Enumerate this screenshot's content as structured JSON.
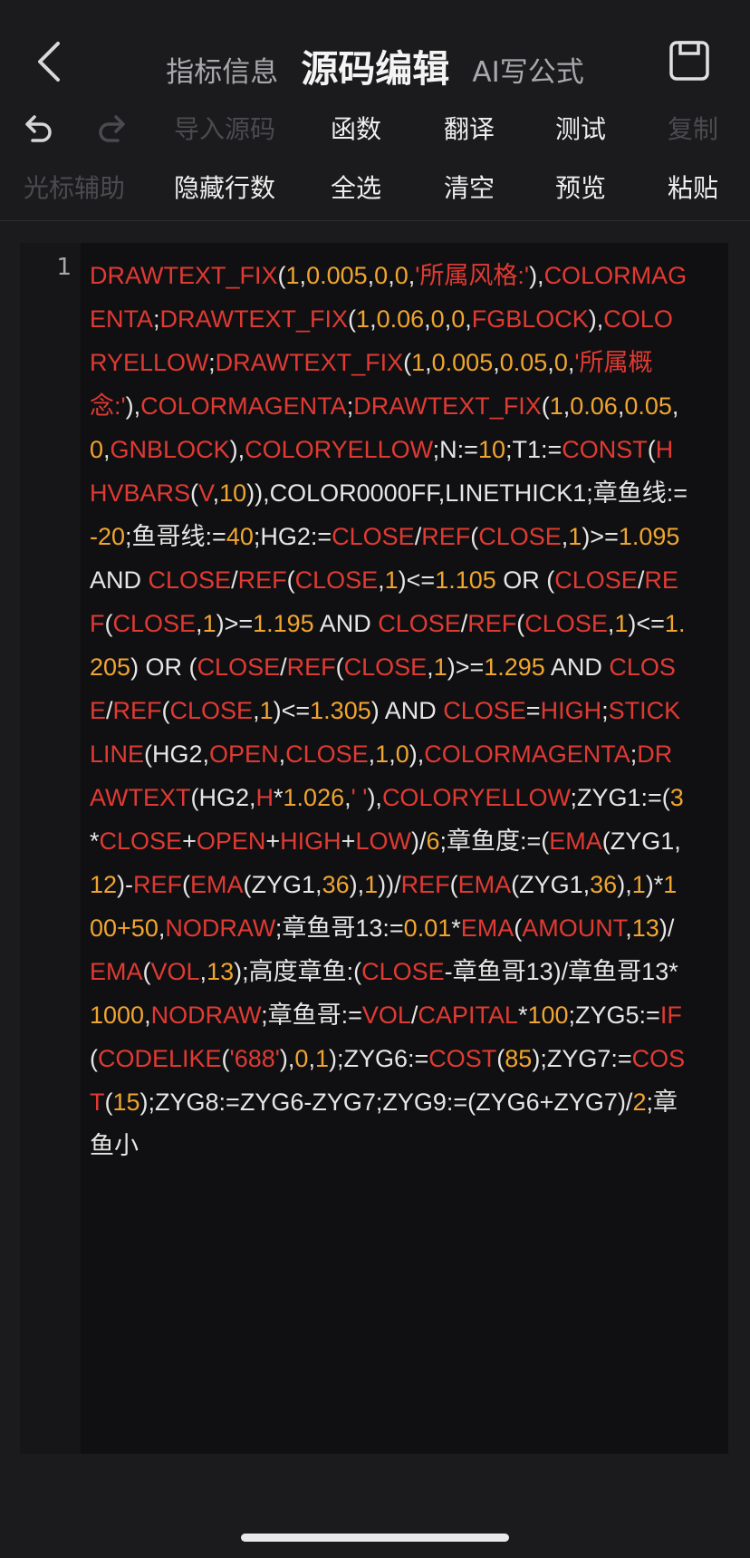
{
  "nav": {
    "tabs": [
      {
        "label": "指标信息"
      },
      {
        "label": "源码编辑"
      },
      {
        "label": "AI写公式"
      }
    ]
  },
  "toolbar": {
    "row1": {
      "undo": "undo-icon",
      "redo": "redo-icon",
      "import_source": "导入源码",
      "functions": "函数",
      "translate": "翻译",
      "test": "测试",
      "copy": "复制"
    },
    "row2": {
      "cursor_assist": "光标辅助",
      "hide_line_numbers": "隐藏行数",
      "select_all": "全选",
      "clear": "清空",
      "preview": "预览",
      "paste": "粘贴"
    }
  },
  "editor": {
    "line_number": "1",
    "tokens": [
      [
        "f",
        "DRAWTEXT_FIX"
      ],
      [
        "p",
        "("
      ],
      [
        "n",
        "1"
      ],
      [
        "p",
        ","
      ],
      [
        "n",
        "0.005"
      ],
      [
        "p",
        ","
      ],
      [
        "n",
        "0"
      ],
      [
        "p",
        ","
      ],
      [
        "n",
        "0"
      ],
      [
        "p",
        ","
      ],
      [
        "s",
        "'所属风格:'"
      ],
      [
        "p",
        "),"
      ],
      [
        "f",
        "COLORMAGENTA"
      ],
      [
        "p",
        ";"
      ],
      [
        "f",
        "DRAWTEXT_FIX"
      ],
      [
        "p",
        "("
      ],
      [
        "n",
        "1"
      ],
      [
        "p",
        ","
      ],
      [
        "n",
        "0.06"
      ],
      [
        "p",
        ","
      ],
      [
        "n",
        "0"
      ],
      [
        "p",
        ","
      ],
      [
        "n",
        "0"
      ],
      [
        "p",
        ","
      ],
      [
        "f",
        "FGBLOCK"
      ],
      [
        "p",
        "),"
      ],
      [
        "f",
        "COLORYELLOW"
      ],
      [
        "p",
        ";"
      ],
      [
        "f",
        "DRAWTEXT_FIX"
      ],
      [
        "p",
        "("
      ],
      [
        "n",
        "1"
      ],
      [
        "p",
        ","
      ],
      [
        "n",
        "0.005"
      ],
      [
        "p",
        ","
      ],
      [
        "n",
        "0.05"
      ],
      [
        "p",
        ","
      ],
      [
        "n",
        "0"
      ],
      [
        "p",
        ","
      ],
      [
        "s",
        "'所属概念:'"
      ],
      [
        "p",
        "),"
      ],
      [
        "f",
        "COLORMAGENTA"
      ],
      [
        "p",
        ";"
      ],
      [
        "f",
        "DRAWTEXT_FIX"
      ],
      [
        "p",
        "("
      ],
      [
        "n",
        "1"
      ],
      [
        "p",
        ","
      ],
      [
        "n",
        "0.06"
      ],
      [
        "p",
        ","
      ],
      [
        "n",
        "0.05"
      ],
      [
        "p",
        ","
      ],
      [
        "n",
        "0"
      ],
      [
        "p",
        ","
      ],
      [
        "f",
        "GNBLOCK"
      ],
      [
        "p",
        "),"
      ],
      [
        "f",
        "COLORYELLOW"
      ],
      [
        "p",
        ";N:="
      ],
      [
        "n",
        "10"
      ],
      [
        "p",
        ";T1:="
      ],
      [
        "f",
        "CONST"
      ],
      [
        "p",
        "("
      ],
      [
        "f",
        "HHVBARS"
      ],
      [
        "p",
        "("
      ],
      [
        "f",
        "V"
      ],
      [
        "p",
        ","
      ],
      [
        "n",
        "10"
      ],
      [
        "p",
        "))"
      ],
      [
        "p",
        ",COLOR0000FF,LINETHICK1;章鱼线:="
      ],
      [
        "n",
        "-20"
      ],
      [
        "p",
        ";鱼哥线:="
      ],
      [
        "n",
        "40"
      ],
      [
        "p",
        ";HG2:="
      ],
      [
        "f",
        "CLOSE"
      ],
      [
        "p",
        "/"
      ],
      [
        "f",
        "REF"
      ],
      [
        "p",
        "("
      ],
      [
        "f",
        "CLOSE"
      ],
      [
        "p",
        ","
      ],
      [
        "n",
        "1"
      ],
      [
        "p",
        ")>="
      ],
      [
        "n",
        "1.095"
      ],
      [
        "p",
        " AND "
      ],
      [
        "f",
        "CLOSE"
      ],
      [
        "p",
        "/"
      ],
      [
        "f",
        "REF"
      ],
      [
        "p",
        "("
      ],
      [
        "f",
        "CLOSE"
      ],
      [
        "p",
        ","
      ],
      [
        "n",
        "1"
      ],
      [
        "p",
        ")<="
      ],
      [
        "n",
        "1.105"
      ],
      [
        "p",
        " OR ("
      ],
      [
        "f",
        "CLOSE"
      ],
      [
        "p",
        "/"
      ],
      [
        "f",
        "REF"
      ],
      [
        "p",
        "("
      ],
      [
        "f",
        "CLOSE"
      ],
      [
        "p",
        ","
      ],
      [
        "n",
        "1"
      ],
      [
        "p",
        ")>="
      ],
      [
        "n",
        "1.195"
      ],
      [
        "p",
        " AND "
      ],
      [
        "f",
        "CLOSE"
      ],
      [
        "p",
        "/"
      ],
      [
        "f",
        "REF"
      ],
      [
        "p",
        "("
      ],
      [
        "f",
        "CLOSE"
      ],
      [
        "p",
        ","
      ],
      [
        "n",
        "1"
      ],
      [
        "p",
        ")<="
      ],
      [
        "n",
        "1.205"
      ],
      [
        "p",
        ") OR ("
      ],
      [
        "f",
        "CLOSE"
      ],
      [
        "p",
        "/"
      ],
      [
        "f",
        "REF"
      ],
      [
        "p",
        "("
      ],
      [
        "f",
        "CLOSE"
      ],
      [
        "p",
        ","
      ],
      [
        "n",
        "1"
      ],
      [
        "p",
        ")>="
      ],
      [
        "n",
        "1.295"
      ],
      [
        "p",
        " AND "
      ],
      [
        "f",
        "CLOSE"
      ],
      [
        "p",
        "/"
      ],
      [
        "f",
        "REF"
      ],
      [
        "p",
        "("
      ],
      [
        "f",
        "CLOSE"
      ],
      [
        "p",
        ","
      ],
      [
        "n",
        "1"
      ],
      [
        "p",
        ")<="
      ],
      [
        "n",
        "1.305"
      ],
      [
        "p",
        ") AND "
      ],
      [
        "f",
        "CLOSE"
      ],
      [
        "p",
        "="
      ],
      [
        "f",
        "HIGH"
      ],
      [
        "p",
        ";"
      ],
      [
        "f",
        "STICKLINE"
      ],
      [
        "p",
        "(HG2,"
      ],
      [
        "f",
        "OPEN"
      ],
      [
        "p",
        ","
      ],
      [
        "f",
        "CLOSE"
      ],
      [
        "p",
        ","
      ],
      [
        "n",
        "1"
      ],
      [
        "p",
        ","
      ],
      [
        "n",
        "0"
      ],
      [
        "p",
        "),"
      ],
      [
        "f",
        "COLORMAGENTA"
      ],
      [
        "p",
        ";"
      ],
      [
        "f",
        "DRAWTEXT"
      ],
      [
        "p",
        "(HG2,"
      ],
      [
        "f",
        "H"
      ],
      [
        "p",
        "*"
      ],
      [
        "n",
        "1.026"
      ],
      [
        "p",
        ","
      ],
      [
        "s",
        "' '"
      ],
      [
        "p",
        "),"
      ],
      [
        "f",
        "COLORYELLOW"
      ],
      [
        "p",
        ";ZYG1:=("
      ],
      [
        "n",
        "3"
      ],
      [
        "p",
        "*"
      ],
      [
        "f",
        "CLOSE"
      ],
      [
        "p",
        "+"
      ],
      [
        "f",
        "OPEN"
      ],
      [
        "p",
        "+"
      ],
      [
        "f",
        "HIGH"
      ],
      [
        "p",
        "+"
      ],
      [
        "f",
        "LOW"
      ],
      [
        "p",
        ")/"
      ],
      [
        "n",
        "6"
      ],
      [
        "p",
        ";章鱼度:=("
      ],
      [
        "f",
        "EMA"
      ],
      [
        "p",
        "(ZYG1,"
      ],
      [
        "n",
        "12"
      ],
      [
        "p",
        ")-"
      ],
      [
        "f",
        "REF"
      ],
      [
        "p",
        "("
      ],
      [
        "f",
        "EMA"
      ],
      [
        "p",
        "(ZYG1,"
      ],
      [
        "n",
        "36"
      ],
      [
        "p",
        "),"
      ],
      [
        "n",
        "1"
      ],
      [
        "p",
        "))/"
      ],
      [
        "f",
        "REF"
      ],
      [
        "p",
        "("
      ],
      [
        "f",
        "EMA"
      ],
      [
        "p",
        "(ZYG1,"
      ],
      [
        "n",
        "36"
      ],
      [
        "p",
        "),"
      ],
      [
        "n",
        "1"
      ],
      [
        "p",
        ")*"
      ],
      [
        "n",
        "100+50"
      ],
      [
        "p",
        ","
      ],
      [
        "f",
        "NODRAW"
      ],
      [
        "p",
        ";章鱼哥13:="
      ],
      [
        "n",
        "0.01"
      ],
      [
        "p",
        "*"
      ],
      [
        "f",
        "EMA"
      ],
      [
        "p",
        "("
      ],
      [
        "f",
        "AMOUNT"
      ],
      [
        "p",
        ","
      ],
      [
        "n",
        "13"
      ],
      [
        "p",
        ")/"
      ],
      [
        "f",
        "EMA"
      ],
      [
        "p",
        "("
      ],
      [
        "f",
        "VOL"
      ],
      [
        "p",
        ","
      ],
      [
        "n",
        "13"
      ],
      [
        "p",
        ");高度章鱼:("
      ],
      [
        "f",
        "CLOSE"
      ],
      [
        "p",
        "-章鱼哥13)/章鱼哥13*"
      ],
      [
        "n",
        "1000"
      ],
      [
        "p",
        ","
      ],
      [
        "f",
        "NODRAW"
      ],
      [
        "p",
        ";章鱼哥:="
      ],
      [
        "f",
        "VOL"
      ],
      [
        "p",
        "/"
      ],
      [
        "f",
        "CAPITAL"
      ],
      [
        "p",
        "*"
      ],
      [
        "n",
        "100"
      ],
      [
        "p",
        ";ZYG5:="
      ],
      [
        "f",
        "IF"
      ],
      [
        "p",
        "("
      ],
      [
        "f",
        "CODELIKE"
      ],
      [
        "p",
        "("
      ],
      [
        "s",
        "'688'"
      ],
      [
        "p",
        "),"
      ],
      [
        "n",
        "0"
      ],
      [
        "p",
        ","
      ],
      [
        "n",
        "1"
      ],
      [
        "p",
        ");ZYG6:="
      ],
      [
        "f",
        "COST"
      ],
      [
        "p",
        "("
      ],
      [
        "n",
        "85"
      ],
      [
        "p",
        ");ZYG7:="
      ],
      [
        "f",
        "COST"
      ],
      [
        "p",
        "("
      ],
      [
        "n",
        "15"
      ],
      [
        "p",
        ");ZYG8:=ZYG6-ZYG7;ZYG9:=(ZYG6+ZYG7)/"
      ],
      [
        "n",
        "2"
      ],
      [
        "p",
        ";章鱼小"
      ]
    ]
  },
  "colors": {
    "background": "#1b1b1d",
    "editor_bg": "#101012",
    "function": "#e03a33",
    "number": "#f0a530",
    "text": "#e6e6e6"
  }
}
